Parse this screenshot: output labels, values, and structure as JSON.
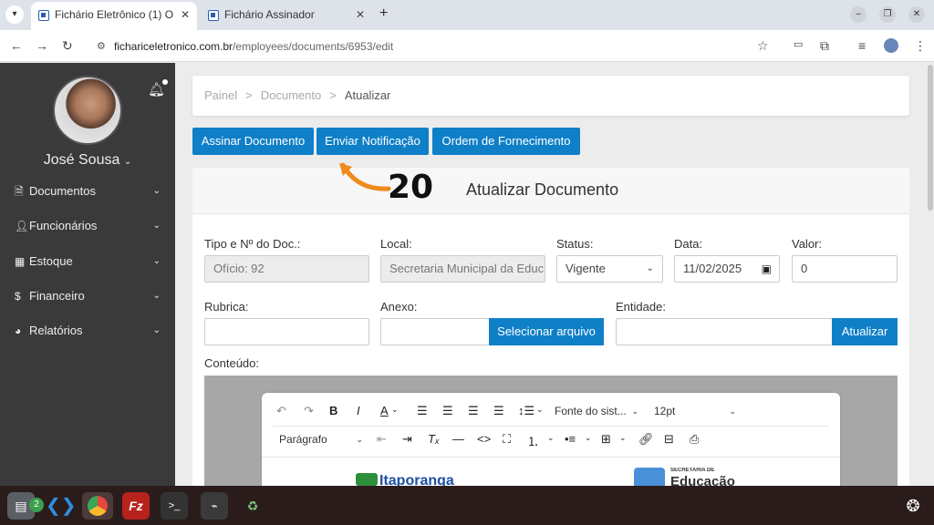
{
  "browser": {
    "tabs": [
      {
        "label": "Fichário Eletrônico (1) O"
      },
      {
        "label": "Fichário Assinador"
      }
    ],
    "url_host": "fichario eletronico.com.br",
    "url_display_host": "fichariceletronico.com.br",
    "url_path": "/employees/documents/6953/edit"
  },
  "sidebar": {
    "user_name": "José Sousa",
    "items": [
      {
        "label": "Documentos",
        "icon": "file-word-icon"
      },
      {
        "label": "Funcionários",
        "icon": "user-icon"
      },
      {
        "label": "Estoque",
        "icon": "boxes-icon"
      },
      {
        "label": "Financeiro",
        "icon": "dollar-icon"
      },
      {
        "label": "Relatórios",
        "icon": "pie-chart-icon"
      }
    ]
  },
  "breadcrumb": {
    "items": [
      "Painel",
      "Documento"
    ],
    "current": "Atualizar"
  },
  "actions": {
    "sign": "Assinar Documento",
    "notify": "Enviar Notificação",
    "order": "Ordem de Fornecimento"
  },
  "annotation": {
    "number": "20",
    "color": "#f08a1c"
  },
  "form": {
    "title": "Atualizar Documento",
    "doc_type_label": "Tipo e Nº do Doc.:",
    "doc_type_value": "Ofício: 92",
    "local_label": "Local:",
    "local_value": "Secretaria Municipal da Educ",
    "status_label": "Status:",
    "status_value": "Vigente",
    "date_label": "Data:",
    "date_value": "11/02/2025",
    "value_label": "Valor:",
    "value_value": "0",
    "rubric_label": "Rubrica:",
    "attach_label": "Anexo:",
    "attach_button": "Selecionar arquivo",
    "entity_label": "Entidade:",
    "entity_button": "Atualizar",
    "content_label": "Conteúdo:"
  },
  "editor": {
    "font_select": "Fonte do sist...",
    "size_select": "12pt",
    "block_select": "Parágrafo",
    "logo_left": "Itaporanga",
    "logo_right_small": "SECRETARIA DE",
    "logo_right": "Educação"
  },
  "taskbar": {
    "files_badge": "2"
  },
  "colors": {
    "primary": "#0f7fc8",
    "sidebar": "#3a3a3a",
    "annotation": "#f08a1c"
  }
}
